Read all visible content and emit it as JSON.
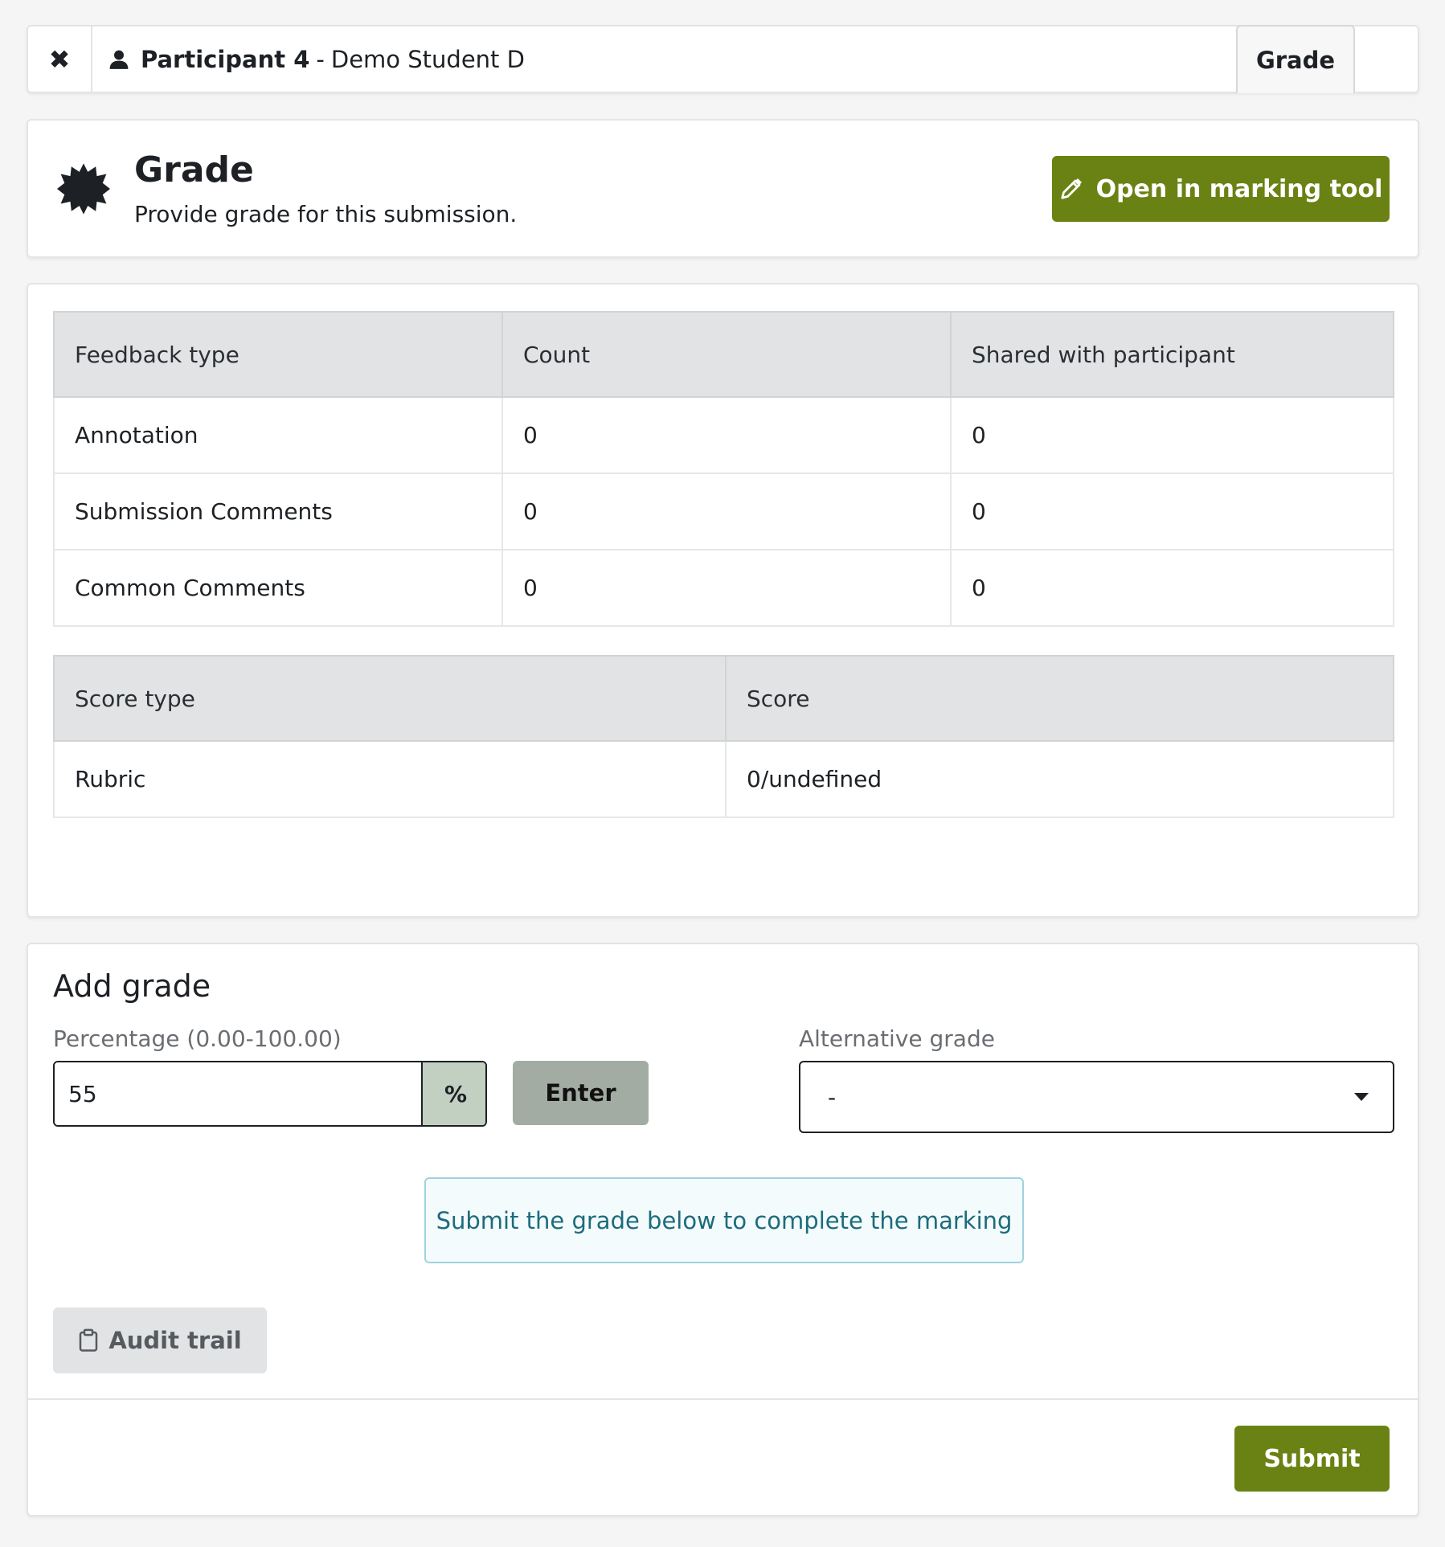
{
  "header": {
    "close_icon": "close-icon",
    "participant_label": "Participant 4",
    "separator": "-",
    "student_name": "Demo Student D",
    "tab_grade": "Grade"
  },
  "grade_panel": {
    "title": "Grade",
    "subtitle": "Provide grade for this submission.",
    "icon": "seal-icon",
    "open_marking_label": "Open in marking tool",
    "accent_color": "#6a8213"
  },
  "feedback_table": {
    "headers": [
      "Feedback type",
      "Count",
      "Shared with participant"
    ],
    "rows": [
      [
        "Annotation",
        "0",
        "0"
      ],
      [
        "Submission Comments",
        "0",
        "0"
      ],
      [
        "Common Comments",
        "0",
        "0"
      ]
    ]
  },
  "score_table": {
    "headers": [
      "Score type",
      "Score"
    ],
    "rows": [
      [
        "Rubric",
        "0/undefined"
      ]
    ]
  },
  "add_grade": {
    "title": "Add grade",
    "percentage_label": "Percentage (0.00-100.00)",
    "percentage_value": "55",
    "percent_addon": "%",
    "enter_label": "Enter",
    "alternative_label": "Alternative grade",
    "alternative_selected": "-",
    "info_message": "Submit the grade below to complete the marking",
    "audit_label": "Audit trail",
    "submit_label": "Submit"
  }
}
